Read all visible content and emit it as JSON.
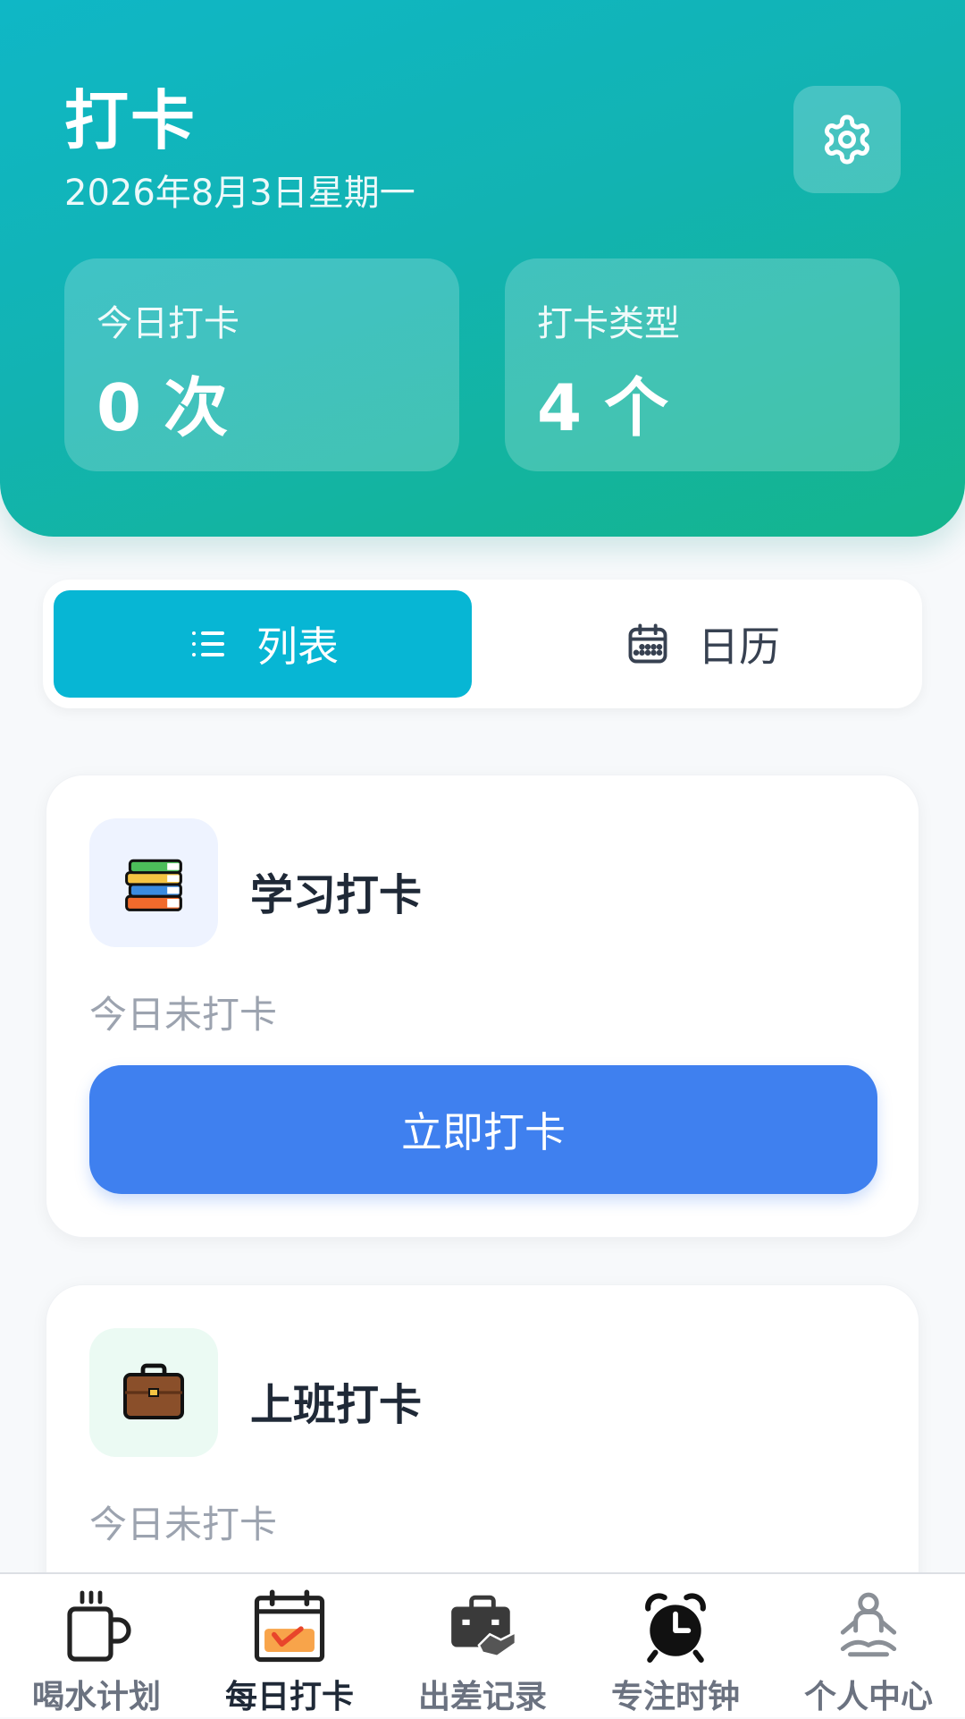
{
  "header": {
    "title": "打卡",
    "date": "2026年8月3日星期一",
    "settings_icon": "gear-icon",
    "stats": {
      "today_label": "今日打卡",
      "today_value": "0 次",
      "types_label": "打卡类型",
      "types_value": "4 个"
    }
  },
  "view_toggle": {
    "list_label": "列表",
    "list_icon": "list-icon",
    "calendar_label": "日历",
    "calendar_icon": "calendar-icon",
    "active": "list",
    "active_color": "#07b6d4"
  },
  "cards": [
    {
      "icon": "books-icon",
      "title": "学习打卡",
      "status": "今日未打卡",
      "button_label": "立即打卡",
      "button_color": "#3f80ef"
    },
    {
      "icon": "briefcase-icon",
      "title": "上班打卡",
      "status": "今日未打卡"
    }
  ],
  "bottom_nav": {
    "active_index": 1,
    "items": [
      {
        "label": "喝水计划",
        "icon": "coffee-mug-icon"
      },
      {
        "label": "每日打卡",
        "icon": "calendar-check-icon"
      },
      {
        "label": "出差记录",
        "icon": "travel-case-icon"
      },
      {
        "label": "专注时钟",
        "icon": "alarm-clock-icon"
      },
      {
        "label": "个人中心",
        "icon": "meditation-person-icon"
      }
    ]
  }
}
